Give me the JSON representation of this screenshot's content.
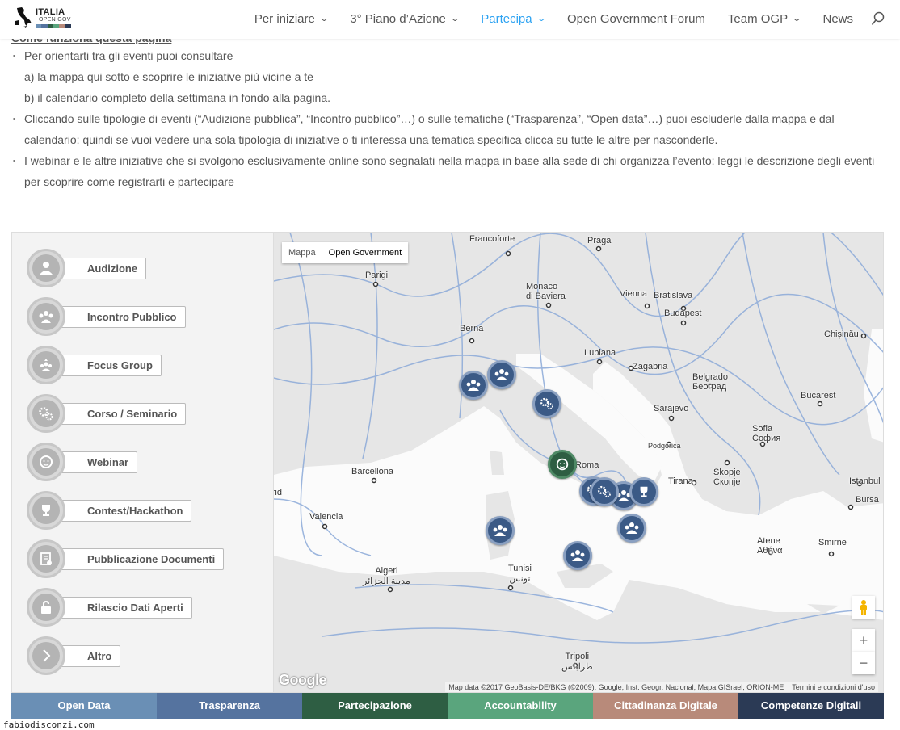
{
  "header": {
    "logo": {
      "line1": "ITALIA",
      "line2": "OPEN GOV"
    },
    "nav": [
      {
        "label": "Per iniziare",
        "dropdown": true,
        "active": false
      },
      {
        "label": "3° Piano d’Azione",
        "dropdown": true,
        "active": false
      },
      {
        "label": "Partecipa",
        "dropdown": true,
        "active": true
      },
      {
        "label": "Open Government Forum",
        "dropdown": false,
        "active": false
      },
      {
        "label": "Team OGP",
        "dropdown": true,
        "active": false
      },
      {
        "label": "News",
        "dropdown": false,
        "active": false
      }
    ],
    "accent_color": "#2ea3f2"
  },
  "intro": {
    "title": "Come funziona questa pagina",
    "items": [
      "Per orientarti tra gli eventi puoi consultare",
      "a) la mappa qui sotto e scoprire le iniziative più vicine a te",
      "b) il calendario completo della settimana in fondo alla pagina.",
      "Cliccando sulle tipologie di eventi (“Audizione pubblica”, “Incontro pubblico”…) o sulle tematiche (“Trasparenza”, “Open data”…) puoi escluderle dalla mappa e dal calendario: quindi se vuoi vedere una sola tipologia di iniziative o ti interessa una tematica specifica clicca su tutte le altre per nasconderle.",
      "I webinar e le altre iniziative che si svolgono esclusivamente online sono segnalati nella mappa in base alla sede di chi organizza l’evento: leggi le descrizione degli eventi per scoprire come registrarti e partecipare"
    ]
  },
  "filters": [
    {
      "label": "Audizione",
      "icon": "person-icon"
    },
    {
      "label": "Incontro Pubblico",
      "icon": "group-icon"
    },
    {
      "label": "Focus Group",
      "icon": "focus-group-icon"
    },
    {
      "label": "Corso / Seminario",
      "icon": "gears-icon"
    },
    {
      "label": "Webinar",
      "icon": "webinar-face-icon"
    },
    {
      "label": "Contest/Hackathon",
      "icon": "trophy-icon"
    },
    {
      "label": "Pubblicazione Documenti",
      "icon": "document-icon"
    },
    {
      "label": "Rilascio Dati Aperti",
      "icon": "unlock-icon"
    },
    {
      "label": "Altro",
      "icon": "chevron-right-icon"
    }
  ],
  "map": {
    "map_types": [
      {
        "label": "Mappa",
        "selected": false
      },
      {
        "label": "Open Government",
        "selected": true
      }
    ],
    "cities": [
      "Francoforte",
      "Praga",
      "Parigi",
      "Monaco\ndi Baviera",
      "Vienna",
      "Bratislava",
      "Budapest",
      "Berna",
      "Chișinău",
      "Lubiana",
      "Zagabria",
      "Belgrado\nБеоград",
      "Bucarest",
      "Sarajevo",
      "Sofia\nСофия",
      "Podgorica",
      "Barcellona",
      "Tirana",
      "Skopje\nСкопје",
      "Istanbul",
      "Bursa",
      "Valencia",
      "Atene\nΑθήνα",
      "Smirne",
      "Algeri\nمدينة الجزائر",
      "Tunisi\nتونس",
      "Tripoli\nطرابلس",
      "Roma",
      "Madrid"
    ],
    "google_logo": "Google",
    "attribution": "Map data ©2017 GeoBasis-DE/BKG (©2009), Google, Inst. Geogr. Nacional, Mapa GISrael, ORION-ME",
    "terms": "Termini e condizioni d'uso",
    "zoom_in": "+",
    "zoom_out": "−"
  },
  "themes": [
    {
      "label": "Open Data",
      "color": "#6a8fb5"
    },
    {
      "label": "Trasparenza",
      "color": "#55739f"
    },
    {
      "label": "Partecipazione",
      "color": "#2e5e43"
    },
    {
      "label": "Accountability",
      "color": "#5aa57d"
    },
    {
      "label": "Cittadinanza Digitale",
      "color": "#b88a7a"
    },
    {
      "label": "Competenze Digitali",
      "color": "#2b3a55"
    }
  ],
  "watermark": "fabiodisconzi.com"
}
